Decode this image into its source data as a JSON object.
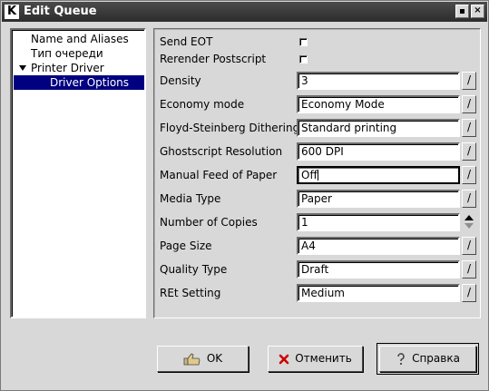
{
  "window": {
    "title": "Edit Queue",
    "logo": "K"
  },
  "titlebar_buttons": {
    "sticky_icon": "sticky-icon",
    "close_label": "×"
  },
  "tree": {
    "items": [
      {
        "label": "Name and Aliases",
        "level": 1,
        "selected": false
      },
      {
        "label": "Тип очереди",
        "level": 1,
        "selected": false
      },
      {
        "label": "Printer Driver",
        "level": 1,
        "selected": false,
        "expanded": true
      },
      {
        "label": "Driver Options",
        "level": 2,
        "selected": true
      }
    ]
  },
  "options": {
    "send_eot": {
      "label": "Send EOT",
      "checked": false
    },
    "rerender_postscript": {
      "label": "Rerender Postscript",
      "checked": false
    },
    "density": {
      "label": "Density",
      "value": "3"
    },
    "economy_mode": {
      "label": "Economy mode",
      "value": "Economy Mode"
    },
    "dithering": {
      "label": "Floyd-Steinberg Dithering",
      "value": "Standard printing"
    },
    "resolution": {
      "label": "Ghostscript Resolution",
      "value": "600 DPI"
    },
    "manual_feed": {
      "label": "Manual Feed of Paper",
      "value": "Off"
    },
    "media_type": {
      "label": "Media Type",
      "value": "Paper"
    },
    "copies": {
      "label": "Number of Copies",
      "value": "1"
    },
    "page_size": {
      "label": "Page Size",
      "value": "A4"
    },
    "quality_type": {
      "label": "Quality Type",
      "value": "Draft"
    },
    "ret_setting": {
      "label": "REt Setting",
      "value": "Medium"
    },
    "edit_button_label": "/"
  },
  "buttons": {
    "ok": "OK",
    "cancel": "Отменить",
    "help": "Справка"
  },
  "colors": {
    "selection": "#000080",
    "titlebar": "#3a3a3a",
    "cancel_icon": "#cc0000"
  }
}
